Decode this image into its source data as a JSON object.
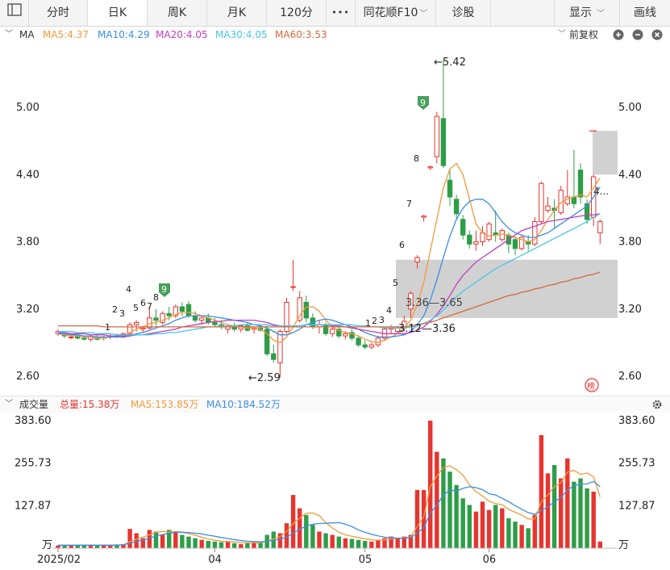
{
  "tabs": {
    "intraday": "分时",
    "daily": "日K",
    "weekly": "周K",
    "monthly": "月K",
    "min120": "120分",
    "more": "•••",
    "f10": "同花顺F10",
    "diagnose": "诊股",
    "display": "显示",
    "draw": "画线"
  },
  "ma_legend": {
    "label": "MA",
    "ma5": "MA5:4.37",
    "ma10": "MA10:4.29",
    "ma20": "MA20:4.05",
    "ma30": "MA30:4.05",
    "ma60": "MA60:3.53",
    "adjust": "前复权"
  },
  "vol_legend": {
    "label": "成交量",
    "total": "总量:15.38万",
    "ma5": "MA5:153.85万",
    "ma10": "MA10:184.52万"
  },
  "colors": {
    "up": "#e8342f",
    "down": "#2e9d48",
    "ma5": "#f29a38",
    "ma10": "#3a8ee6",
    "ma20": "#c13fbc",
    "ma30": "#48c6e8",
    "ma60": "#d46a3c"
  },
  "icons": [
    "panel-toggle-icon",
    "gear-icon",
    "zoom-in-icon",
    "zoom-out-icon",
    "close-icon",
    "chevron-down-icon"
  ],
  "chart_data": [
    {
      "type": "candlestick",
      "y_ticks": [
        "5.00",
        "4.40",
        "3.80",
        "3.20",
        "2.60"
      ],
      "ylim": [
        2.5,
        5.5
      ],
      "x_ticks": [
        "2025/02",
        "04",
        "05",
        "06"
      ],
      "candles": [
        [
          2.98,
          3.02,
          2.96,
          3.0
        ],
        [
          2.97,
          2.99,
          2.94,
          2.96
        ],
        [
          2.95,
          2.98,
          2.93,
          2.95
        ],
        [
          2.96,
          2.97,
          2.93,
          2.94
        ],
        [
          2.94,
          2.96,
          2.92,
          2.93
        ],
        [
          2.93,
          2.96,
          2.91,
          2.95
        ],
        [
          2.95,
          2.97,
          2.92,
          2.93
        ],
        [
          2.94,
          2.96,
          2.92,
          2.95
        ],
        [
          2.95,
          2.98,
          2.93,
          2.96
        ],
        [
          2.96,
          2.98,
          2.94,
          2.95
        ],
        [
          2.95,
          2.99,
          2.94,
          2.98
        ],
        [
          2.98,
          3.08,
          2.97,
          3.06
        ],
        [
          3.06,
          3.1,
          3.0,
          3.08
        ],
        [
          3.02,
          3.05,
          2.99,
          3.03
        ],
        [
          3.03,
          3.22,
          3.02,
          3.12
        ],
        [
          3.12,
          3.2,
          3.05,
          3.1
        ],
        [
          3.08,
          3.18,
          3.06,
          3.16
        ],
        [
          3.16,
          3.22,
          3.1,
          3.14
        ],
        [
          3.14,
          3.24,
          3.12,
          3.22
        ],
        [
          3.22,
          3.26,
          3.14,
          3.18
        ],
        [
          3.24,
          3.27,
          3.12,
          3.14
        ],
        [
          3.14,
          3.18,
          3.08,
          3.1
        ],
        [
          3.1,
          3.14,
          3.06,
          3.12
        ],
        [
          3.12,
          3.16,
          3.06,
          3.08
        ],
        [
          3.08,
          3.12,
          3.04,
          3.06
        ],
        [
          3.06,
          3.1,
          3.02,
          3.04
        ],
        [
          3.02,
          3.06,
          2.98,
          3.04
        ],
        [
          3.04,
          3.08,
          3.0,
          3.02
        ],
        [
          3.02,
          3.06,
          2.99,
          3.05
        ],
        [
          3.05,
          3.08,
          3.0,
          3.01
        ],
        [
          3.02,
          3.04,
          2.98,
          3.03
        ],
        [
          3.03,
          3.06,
          3.0,
          3.01
        ],
        [
          3.02,
          3.05,
          2.78,
          2.8
        ],
        [
          2.8,
          2.88,
          2.72,
          2.75
        ],
        [
          2.72,
          3.02,
          2.59,
          3.0
        ],
        [
          3.0,
          3.3,
          2.98,
          3.26
        ],
        [
          3.4,
          3.64,
          3.36,
          3.4
        ],
        [
          3.1,
          3.36,
          3.08,
          3.3
        ],
        [
          3.26,
          3.32,
          3.08,
          3.12
        ],
        [
          3.12,
          3.16,
          3.02,
          3.04
        ],
        [
          3.04,
          3.1,
          2.98,
          3.06
        ],
        [
          3.06,
          3.08,
          2.96,
          2.98
        ],
        [
          2.98,
          3.04,
          2.95,
          3.02
        ],
        [
          3.02,
          3.05,
          2.94,
          2.96
        ],
        [
          2.96,
          3.0,
          2.93,
          2.98
        ],
        [
          2.99,
          3.02,
          2.92,
          2.94
        ],
        [
          2.94,
          2.96,
          2.86,
          2.88
        ],
        [
          2.88,
          2.92,
          2.84,
          2.86
        ],
        [
          2.86,
          2.9,
          2.84,
          2.88
        ],
        [
          2.88,
          2.96,
          2.86,
          2.94
        ],
        [
          2.94,
          3.04,
          2.92,
          3.02
        ],
        [
          3.02,
          3.06,
          2.98,
          3.04
        ],
        [
          3.0,
          3.05,
          2.98,
          3.03
        ],
        [
          3.03,
          3.14,
          3.0,
          3.09
        ],
        [
          3.2,
          3.36,
          3.12,
          3.34
        ],
        [
          3.62,
          3.68,
          3.56,
          3.66
        ],
        [
          4.02,
          4.04,
          3.98,
          4.03
        ],
        [
          4.46,
          4.48,
          4.44,
          4.47
        ],
        [
          4.56,
          4.96,
          4.5,
          4.92
        ],
        [
          4.9,
          5.42,
          4.46,
          4.48
        ],
        [
          4.35,
          4.45,
          4.12,
          4.2
        ],
        [
          4.18,
          4.22,
          4.0,
          4.05
        ],
        [
          4.0,
          4.04,
          3.82,
          3.86
        ],
        [
          3.86,
          3.9,
          3.74,
          3.78
        ],
        [
          3.78,
          3.9,
          3.72,
          3.8
        ],
        [
          3.8,
          3.94,
          3.76,
          3.88
        ],
        [
          3.82,
          3.98,
          3.8,
          3.96
        ],
        [
          3.88,
          4.08,
          3.8,
          3.86
        ],
        [
          3.82,
          3.92,
          3.8,
          3.9
        ],
        [
          3.86,
          3.88,
          3.7,
          3.78
        ],
        [
          3.82,
          3.84,
          3.68,
          3.74
        ],
        [
          3.74,
          3.86,
          3.72,
          3.84
        ],
        [
          3.8,
          3.86,
          3.72,
          3.78
        ],
        [
          3.78,
          4.02,
          3.76,
          3.98
        ],
        [
          3.98,
          4.34,
          3.96,
          4.32
        ],
        [
          4.08,
          4.2,
          4.06,
          4.12
        ],
        [
          4.1,
          4.18,
          3.92,
          4.08
        ],
        [
          4.06,
          4.3,
          4.04,
          4.26
        ],
        [
          4.14,
          4.44,
          4.12,
          4.2
        ],
        [
          4.2,
          4.62,
          4.1,
          4.14
        ],
        [
          4.44,
          4.5,
          4.14,
          4.2
        ],
        [
          4.14,
          4.18,
          3.96,
          4.0
        ],
        [
          4.02,
          4.4,
          3.94,
          4.38
        ],
        [
          3.88,
          4.0,
          3.78,
          3.98
        ]
      ],
      "price_labels": [
        "←5.42",
        "←2.59",
        "3.36—3.65",
        "3.12—3.36",
        "4..."
      ],
      "count_labels": [
        "1",
        "2",
        "3",
        "4",
        "5",
        "6",
        "7",
        "8",
        "9",
        "1",
        "2",
        "3",
        "4",
        "5",
        "6",
        "7",
        "8",
        "9"
      ],
      "ma_lines": [
        {
          "name": "MA5",
          "values": [
            2.98,
            2.97,
            2.96,
            2.96,
            2.95,
            2.95,
            2.94,
            2.94,
            2.95,
            2.95,
            2.96,
            2.99,
            3.02,
            3.04,
            3.07,
            3.08,
            3.1,
            3.12,
            3.15,
            3.17,
            3.17,
            3.16,
            3.14,
            3.12,
            3.1,
            3.08,
            3.06,
            3.05,
            3.04,
            3.03,
            3.03,
            3.02,
            2.98,
            2.92,
            2.9,
            2.95,
            3.04,
            3.14,
            3.22,
            3.22,
            3.18,
            3.1,
            3.04,
            3.01,
            2.99,
            2.98,
            2.96,
            2.93,
            2.91,
            2.9,
            2.92,
            2.95,
            2.98,
            3.03,
            3.1,
            3.24,
            3.44,
            3.72,
            4.0,
            4.28,
            4.45,
            4.5,
            4.4,
            4.18,
            3.96,
            3.88,
            3.85,
            3.86,
            3.87,
            3.86,
            3.84,
            3.82,
            3.8,
            3.82,
            3.9,
            4.0,
            4.08,
            4.15,
            4.18,
            4.2,
            4.22,
            4.2,
            4.28,
            4.37
          ]
        },
        {
          "name": "MA10",
          "values": [
            2.98,
            2.98,
            2.97,
            2.97,
            2.96,
            2.96,
            2.95,
            2.95,
            2.95,
            2.95,
            2.95,
            2.96,
            2.98,
            2.99,
            3.01,
            3.03,
            3.05,
            3.07,
            3.1,
            3.12,
            3.14,
            3.14,
            3.14,
            3.14,
            3.13,
            3.12,
            3.11,
            3.1,
            3.09,
            3.08,
            3.06,
            3.05,
            3.03,
            3.0,
            2.97,
            2.97,
            2.99,
            3.02,
            3.06,
            3.08,
            3.1,
            3.11,
            3.1,
            3.08,
            3.06,
            3.04,
            3.02,
            2.99,
            2.97,
            2.95,
            2.95,
            2.95,
            2.96,
            2.97,
            3.0,
            3.06,
            3.14,
            3.28,
            3.46,
            3.66,
            3.85,
            4.0,
            4.1,
            4.16,
            4.18,
            4.18,
            4.14,
            4.06,
            3.98,
            3.92,
            3.88,
            3.86,
            3.84,
            3.84,
            3.86,
            3.88,
            3.92,
            3.96,
            4.0,
            4.04,
            4.08,
            4.12,
            4.2,
            4.29
          ]
        },
        {
          "name": "MA20",
          "values": [
            2.99,
            2.99,
            2.98,
            2.98,
            2.98,
            2.97,
            2.97,
            2.97,
            2.96,
            2.96,
            2.96,
            2.96,
            2.97,
            2.97,
            2.98,
            2.99,
            3.0,
            3.01,
            3.02,
            3.04,
            3.05,
            3.06,
            3.07,
            3.08,
            3.09,
            3.09,
            3.1,
            3.1,
            3.1,
            3.1,
            3.1,
            3.09,
            3.08,
            3.06,
            3.05,
            3.04,
            3.04,
            3.05,
            3.06,
            3.06,
            3.06,
            3.06,
            3.05,
            3.05,
            3.04,
            3.03,
            3.02,
            3.01,
            3.0,
            2.99,
            2.98,
            2.98,
            2.98,
            2.98,
            2.99,
            3.01,
            3.04,
            3.09,
            3.15,
            3.23,
            3.32,
            3.42,
            3.5,
            3.56,
            3.62,
            3.66,
            3.7,
            3.74,
            3.78,
            3.82,
            3.86,
            3.9,
            3.92,
            3.94,
            3.96,
            3.98,
            3.99,
            4.0,
            4.01,
            4.02,
            4.03,
            4.04,
            4.04,
            4.05
          ]
        },
        {
          "name": "MA30",
          "values": [
            3.0,
            3.0,
            3.0,
            2.99,
            2.99,
            2.99,
            2.98,
            2.98,
            2.98,
            2.97,
            2.97,
            2.97,
            2.97,
            2.97,
            2.97,
            2.98,
            2.98,
            2.99,
            2.99,
            3.0,
            3.01,
            3.02,
            3.03,
            3.04,
            3.04,
            3.05,
            3.05,
            3.05,
            3.06,
            3.06,
            3.06,
            3.06,
            3.06,
            3.05,
            3.05,
            3.05,
            3.05,
            3.05,
            3.06,
            3.06,
            3.06,
            3.06,
            3.06,
            3.06,
            3.06,
            3.06,
            3.05,
            3.05,
            3.04,
            3.04,
            3.03,
            3.03,
            3.03,
            3.03,
            3.04,
            3.05,
            3.07,
            3.1,
            3.14,
            3.19,
            3.25,
            3.31,
            3.36,
            3.4,
            3.44,
            3.48,
            3.52,
            3.56,
            3.59,
            3.62,
            3.65,
            3.68,
            3.71,
            3.74,
            3.77,
            3.8,
            3.83,
            3.86,
            3.89,
            3.92,
            3.95,
            3.98,
            4.02,
            4.05
          ]
        },
        {
          "name": "MA60",
          "values": [
            3.05,
            3.05,
            3.05,
            3.05,
            3.05,
            3.05,
            3.05,
            3.04,
            3.04,
            3.04,
            3.04,
            3.04,
            3.04,
            3.04,
            3.04,
            3.04,
            3.04,
            3.04,
            3.04,
            3.04,
            3.04,
            3.04,
            3.04,
            3.04,
            3.04,
            3.04,
            3.04,
            3.04,
            3.04,
            3.04,
            3.04,
            3.04,
            3.04,
            3.04,
            3.04,
            3.04,
            3.04,
            3.04,
            3.04,
            3.04,
            3.04,
            3.04,
            3.04,
            3.04,
            3.04,
            3.04,
            3.04,
            3.04,
            3.04,
            3.04,
            3.04,
            3.04,
            3.04,
            3.04,
            3.05,
            3.06,
            3.07,
            3.08,
            3.1,
            3.12,
            3.14,
            3.16,
            3.18,
            3.2,
            3.22,
            3.24,
            3.26,
            3.28,
            3.3,
            3.32,
            3.33,
            3.35,
            3.36,
            3.38,
            3.39,
            3.41,
            3.42,
            3.44,
            3.45,
            3.47,
            3.48,
            3.5,
            3.51,
            3.53
          ]
        }
      ]
    },
    {
      "type": "bar",
      "title": "成交量",
      "y_ticks": [
        "383.60",
        "255.73",
        "127.87",
        "万"
      ],
      "ylim": [
        0,
        383.6
      ],
      "values": [
        8,
        9,
        8,
        9,
        10,
        9,
        9,
        10,
        10,
        11,
        12,
        58,
        45,
        30,
        55,
        50,
        40,
        55,
        50,
        40,
        35,
        30,
        25,
        22,
        20,
        18,
        20,
        15,
        12,
        15,
        18,
        20,
        40,
        50,
        45,
        75,
        160,
        120,
        100,
        70,
        50,
        45,
        40,
        35,
        30,
        28,
        25,
        22,
        20,
        25,
        30,
        35,
        30,
        35,
        40,
        175,
        175,
        383.6,
        290,
        270,
        230,
        190,
        150,
        130,
        110,
        140,
        115,
        130,
        120,
        90,
        80,
        70,
        60,
        100,
        340,
        225,
        250,
        210,
        270,
        200,
        210,
        180,
        170,
        20
      ],
      "ma5": [
        9,
        9,
        9,
        9,
        9,
        9,
        9,
        9,
        9,
        10,
        10,
        20,
        27,
        33,
        40,
        48,
        50,
        49,
        50,
        48,
        44,
        39,
        33,
        28,
        24,
        21,
        20,
        19,
        17,
        16,
        16,
        16,
        21,
        28,
        35,
        50,
        74,
        90,
        105,
        106,
        98,
        77,
        61,
        48,
        40,
        36,
        32,
        28,
        25,
        24,
        25,
        28,
        30,
        31,
        34,
        65,
        95,
        185,
        217,
        243,
        248,
        236,
        220,
        190,
        170,
        157,
        141,
        134,
        131,
        117,
        108,
        100,
        88,
        88,
        140,
        160,
        185,
        197,
        229,
        234,
        222,
        226,
        215,
        153.85
      ],
      "ma10": [
        9,
        9,
        9,
        9,
        9,
        9,
        9,
        9,
        9,
        9,
        10,
        15,
        20,
        25,
        30,
        37,
        41,
        45,
        48,
        48,
        47,
        45,
        43,
        39,
        36,
        32,
        29,
        26,
        23,
        21,
        20,
        19,
        21,
        24,
        27,
        33,
        45,
        57,
        66,
        72,
        74,
        75,
        76,
        77,
        72,
        65,
        55,
        48,
        42,
        37,
        33,
        31,
        30,
        30,
        32,
        45,
        62,
        105,
        130,
        160,
        175,
        172,
        180,
        185,
        182,
        176,
        164,
        160,
        150,
        140,
        128,
        117,
        107,
        102,
        113,
        125,
        139,
        153,
        175,
        188,
        193,
        193,
        201,
        184.52
      ]
    }
  ]
}
